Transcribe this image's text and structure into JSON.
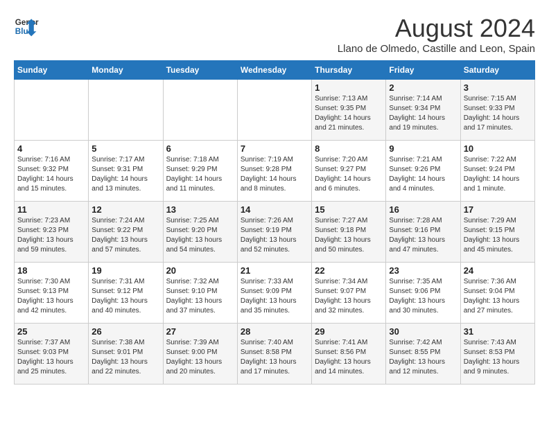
{
  "header": {
    "logo_line1": "General",
    "logo_line2": "Blue",
    "month_year": "August 2024",
    "location": "Llano de Olmedo, Castille and Leon, Spain"
  },
  "days_of_week": [
    "Sunday",
    "Monday",
    "Tuesday",
    "Wednesday",
    "Thursday",
    "Friday",
    "Saturday"
  ],
  "weeks": [
    [
      {
        "day": "",
        "info": ""
      },
      {
        "day": "",
        "info": ""
      },
      {
        "day": "",
        "info": ""
      },
      {
        "day": "",
        "info": ""
      },
      {
        "day": "1",
        "info": "Sunrise: 7:13 AM\nSunset: 9:35 PM\nDaylight: 14 hours\nand 21 minutes."
      },
      {
        "day": "2",
        "info": "Sunrise: 7:14 AM\nSunset: 9:34 PM\nDaylight: 14 hours\nand 19 minutes."
      },
      {
        "day": "3",
        "info": "Sunrise: 7:15 AM\nSunset: 9:33 PM\nDaylight: 14 hours\nand 17 minutes."
      }
    ],
    [
      {
        "day": "4",
        "info": "Sunrise: 7:16 AM\nSunset: 9:32 PM\nDaylight: 14 hours\nand 15 minutes."
      },
      {
        "day": "5",
        "info": "Sunrise: 7:17 AM\nSunset: 9:31 PM\nDaylight: 14 hours\nand 13 minutes."
      },
      {
        "day": "6",
        "info": "Sunrise: 7:18 AM\nSunset: 9:29 PM\nDaylight: 14 hours\nand 11 minutes."
      },
      {
        "day": "7",
        "info": "Sunrise: 7:19 AM\nSunset: 9:28 PM\nDaylight: 14 hours\nand 8 minutes."
      },
      {
        "day": "8",
        "info": "Sunrise: 7:20 AM\nSunset: 9:27 PM\nDaylight: 14 hours\nand 6 minutes."
      },
      {
        "day": "9",
        "info": "Sunrise: 7:21 AM\nSunset: 9:26 PM\nDaylight: 14 hours\nand 4 minutes."
      },
      {
        "day": "10",
        "info": "Sunrise: 7:22 AM\nSunset: 9:24 PM\nDaylight: 14 hours\nand 1 minute."
      }
    ],
    [
      {
        "day": "11",
        "info": "Sunrise: 7:23 AM\nSunset: 9:23 PM\nDaylight: 13 hours\nand 59 minutes."
      },
      {
        "day": "12",
        "info": "Sunrise: 7:24 AM\nSunset: 9:22 PM\nDaylight: 13 hours\nand 57 minutes."
      },
      {
        "day": "13",
        "info": "Sunrise: 7:25 AM\nSunset: 9:20 PM\nDaylight: 13 hours\nand 54 minutes."
      },
      {
        "day": "14",
        "info": "Sunrise: 7:26 AM\nSunset: 9:19 PM\nDaylight: 13 hours\nand 52 minutes."
      },
      {
        "day": "15",
        "info": "Sunrise: 7:27 AM\nSunset: 9:18 PM\nDaylight: 13 hours\nand 50 minutes."
      },
      {
        "day": "16",
        "info": "Sunrise: 7:28 AM\nSunset: 9:16 PM\nDaylight: 13 hours\nand 47 minutes."
      },
      {
        "day": "17",
        "info": "Sunrise: 7:29 AM\nSunset: 9:15 PM\nDaylight: 13 hours\nand 45 minutes."
      }
    ],
    [
      {
        "day": "18",
        "info": "Sunrise: 7:30 AM\nSunset: 9:13 PM\nDaylight: 13 hours\nand 42 minutes."
      },
      {
        "day": "19",
        "info": "Sunrise: 7:31 AM\nSunset: 9:12 PM\nDaylight: 13 hours\nand 40 minutes."
      },
      {
        "day": "20",
        "info": "Sunrise: 7:32 AM\nSunset: 9:10 PM\nDaylight: 13 hours\nand 37 minutes."
      },
      {
        "day": "21",
        "info": "Sunrise: 7:33 AM\nSunset: 9:09 PM\nDaylight: 13 hours\nand 35 minutes."
      },
      {
        "day": "22",
        "info": "Sunrise: 7:34 AM\nSunset: 9:07 PM\nDaylight: 13 hours\nand 32 minutes."
      },
      {
        "day": "23",
        "info": "Sunrise: 7:35 AM\nSunset: 9:06 PM\nDaylight: 13 hours\nand 30 minutes."
      },
      {
        "day": "24",
        "info": "Sunrise: 7:36 AM\nSunset: 9:04 PM\nDaylight: 13 hours\nand 27 minutes."
      }
    ],
    [
      {
        "day": "25",
        "info": "Sunrise: 7:37 AM\nSunset: 9:03 PM\nDaylight: 13 hours\nand 25 minutes."
      },
      {
        "day": "26",
        "info": "Sunrise: 7:38 AM\nSunset: 9:01 PM\nDaylight: 13 hours\nand 22 minutes."
      },
      {
        "day": "27",
        "info": "Sunrise: 7:39 AM\nSunset: 9:00 PM\nDaylight: 13 hours\nand 20 minutes."
      },
      {
        "day": "28",
        "info": "Sunrise: 7:40 AM\nSunset: 8:58 PM\nDaylight: 13 hours\nand 17 minutes."
      },
      {
        "day": "29",
        "info": "Sunrise: 7:41 AM\nSunset: 8:56 PM\nDaylight: 13 hours\nand 14 minutes."
      },
      {
        "day": "30",
        "info": "Sunrise: 7:42 AM\nSunset: 8:55 PM\nDaylight: 13 hours\nand 12 minutes."
      },
      {
        "day": "31",
        "info": "Sunrise: 7:43 AM\nSunset: 8:53 PM\nDaylight: 13 hours\nand 9 minutes."
      }
    ]
  ]
}
